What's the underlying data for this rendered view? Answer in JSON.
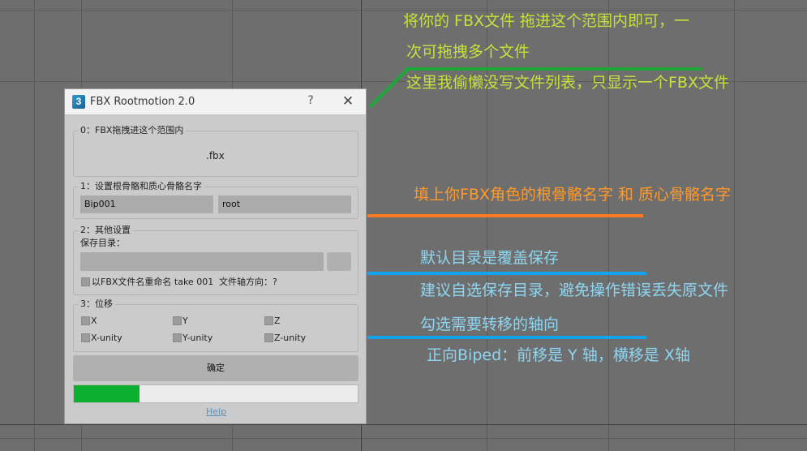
{
  "annotations": [
    {
      "id": "ann1",
      "text": "将你的 FBX文件 拖进这个范围内即可，一",
      "color": "#c8e03a"
    },
    {
      "id": "ann2",
      "text": "次可拖拽多个文件",
      "color": "#c8e03a"
    },
    {
      "id": "ann3",
      "text": "这里我偷懒没写文件列表，只显示一个FBX文件",
      "color": "#c8e03a"
    },
    {
      "id": "ann4",
      "text": "填上你FBX角色的根骨骼名字 和 质心骨骼名字",
      "color": "#ff9a2a"
    },
    {
      "id": "ann5",
      "text": "默认目录是覆盖保存",
      "color": "#8ed6f2"
    },
    {
      "id": "ann6",
      "text": "建议自选保存目录，避免操作错误丢失原文件",
      "color": "#8ed6f2"
    },
    {
      "id": "ann7",
      "text": "勾选需要转移的轴向",
      "color": "#8ed6f2"
    },
    {
      "id": "ann8",
      "text": "正向Biped：前移是 Y 轴，横移是 X轴",
      "color": "#8ed6f2"
    }
  ],
  "colors": {
    "green_line": "#1ea63a",
    "orange_line": "#ff7a21",
    "blue_line": "#16a3ee",
    "progress": "#0caf2f"
  },
  "window": {
    "title": "FBX Rootmotion 2.0",
    "icon": "3ds-max-icon",
    "icon_glyph": "3",
    "help_glyph": "?",
    "close_glyph": "✕"
  },
  "drop_group": {
    "title": "0：FBX拖拽进这个范围内",
    "file": ".fbx"
  },
  "bones_group": {
    "title": "1：设置根骨骼和质心骨骼名字",
    "root_value": "Bip001",
    "mass_value": "root"
  },
  "other_group": {
    "title": "2：其他设置",
    "save_dir_label": "保存目录：",
    "save_dir_value": "",
    "rename_label": "以FBX文件名重命名 take 001",
    "axis_label": "文件轴方向：?"
  },
  "move_group": {
    "title": "3：位移",
    "axes": [
      "X",
      "Y",
      "Z",
      "X-unity",
      "Y-unity",
      "Z-unity"
    ]
  },
  "confirm_label": "确定",
  "progress_percent": 23,
  "help_label": "Help"
}
